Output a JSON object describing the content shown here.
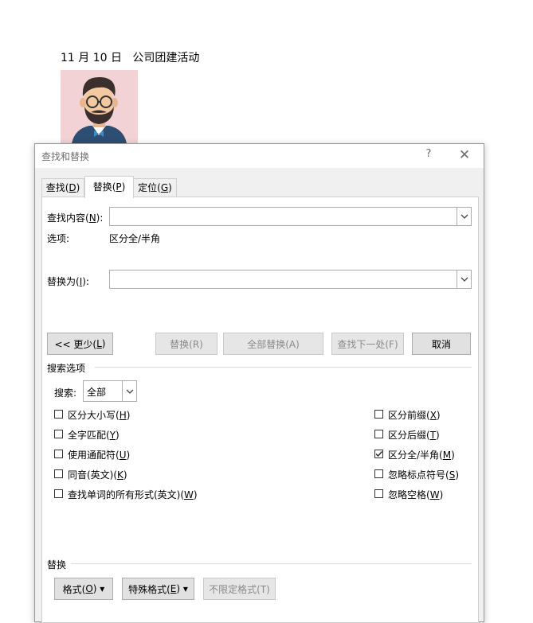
{
  "document": {
    "heading": "11 月 10 日   公司团建活动"
  },
  "dialog": {
    "title": "查找和替换",
    "help": "?",
    "close": "✕",
    "tabs": [
      {
        "label": "查找(",
        "key": "D",
        "tail": ")"
      },
      {
        "label": "替换(",
        "key": "P",
        "tail": ")"
      },
      {
        "label": "定位(",
        "key": "G",
        "tail": ")"
      }
    ],
    "find": {
      "label": "查找内容(",
      "key": "N",
      "tail": "):",
      "value": ""
    },
    "options_label": "选项:",
    "options_value": "区分全/半角",
    "replace": {
      "label": "替换为(",
      "key": "I",
      "tail": "):",
      "value": ""
    },
    "buttons": {
      "less": {
        "label": "<< 更少(",
        "key": "L",
        "tail": ")"
      },
      "replace": "替换(R)",
      "replace_all": "全部替换(A)",
      "find_next": "查找下一处(F)",
      "cancel": "取消"
    },
    "search_options_title": "搜索选项",
    "search": {
      "label": "搜索",
      "key": "",
      "colon": ":",
      "value": "全部"
    },
    "checkboxes_left": [
      {
        "label": "区分大小写(",
        "key": "H",
        "tail": ")",
        "checked": false
      },
      {
        "label": "全字匹配(",
        "key": "Y",
        "tail": ")",
        "checked": false
      },
      {
        "label": "使用通配符(",
        "key": "U",
        "tail": ")",
        "checked": false
      },
      {
        "label": "同音(英文)(",
        "key": "K",
        "tail": ")",
        "checked": false
      },
      {
        "label": "查找单词的所有形式(英文)(",
        "key": "W",
        "tail": ")",
        "checked": false
      }
    ],
    "checkboxes_right": [
      {
        "label": "区分前缀(",
        "key": "X",
        "tail": ")",
        "checked": false
      },
      {
        "label": "区分后缀(",
        "key": "T",
        "tail": ")",
        "checked": false
      },
      {
        "label": "区分全/半角(",
        "key": "M",
        "tail": ")",
        "checked": true
      },
      {
        "label": "忽略标点符号(",
        "key": "S",
        "tail": ")",
        "checked": false
      },
      {
        "label": "忽略空格(",
        "key": "W",
        "tail": ")",
        "checked": false
      }
    ],
    "replace_section_title": "替换",
    "format_buttons": {
      "format": {
        "label": "格式(",
        "key": "O",
        "tail": ") ▾"
      },
      "special": {
        "label": "特殊格式(",
        "key": "E",
        "tail": ") ▾"
      },
      "no_format": "不限定格式(T)"
    }
  }
}
